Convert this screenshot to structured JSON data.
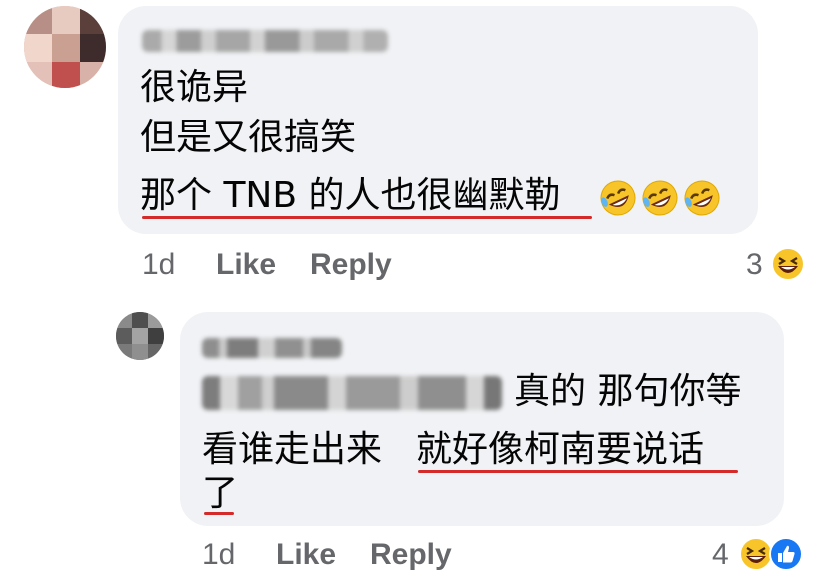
{
  "comment1": {
    "lines": [
      "很诡异",
      "但是又很搞笑",
      "那个 TNB 的人也很幽默勒"
    ],
    "emoji_icon": "rolling-on-floor-laughing-icon",
    "emoji_count_inline": 3,
    "time": "1d",
    "like_label": "Like",
    "reply_label": "Reply",
    "reaction_count": "3",
    "reaction_icon": "laughing-reaction-icon"
  },
  "comment2": {
    "line1_suffix": "真的 那句你等",
    "line2_a": "看谁走出来",
    "line2_b": "就好像柯南要说话",
    "line3": "了",
    "time": "1d",
    "like_label": "Like",
    "reply_label": "Reply",
    "reaction_count": "4",
    "reaction_icons": [
      "laughing-reaction-icon",
      "like-reaction-icon"
    ]
  },
  "colors": {
    "bubble": "#f0f2f5",
    "underline": "#d42a2a",
    "meta_text": "#65676b",
    "like_blue": "#1877f2"
  }
}
